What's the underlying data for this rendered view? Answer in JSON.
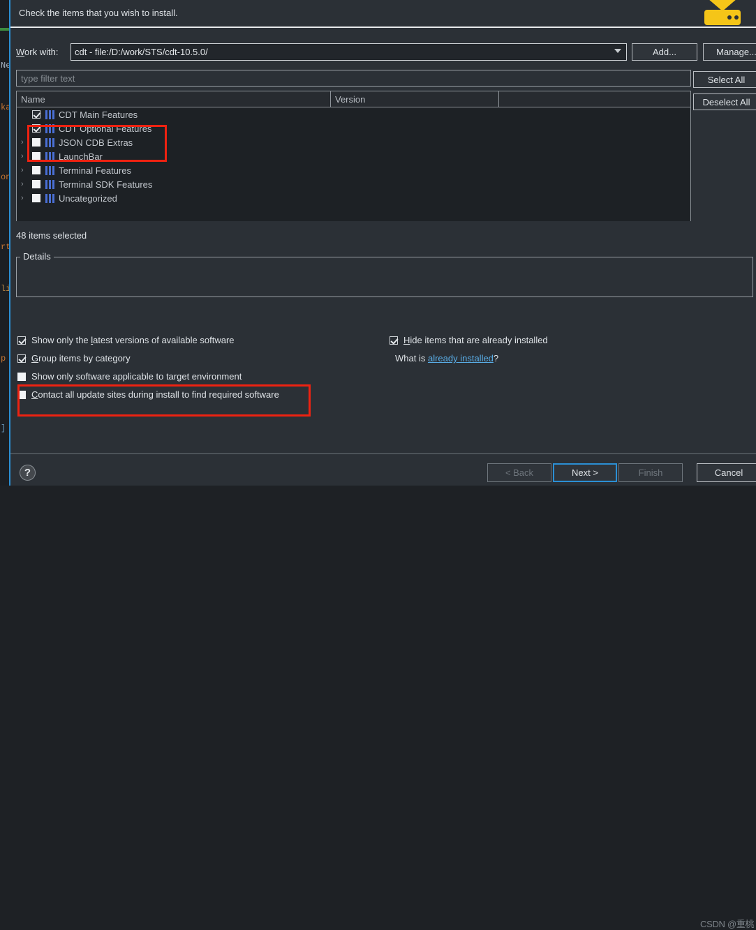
{
  "background_editor": {
    "lines": [
      "",
      "Ne",
      "ka",
      "",
      "on",
      "",
      "rt",
      "li",
      "",
      "p",
      "",
      "]",
      "",
      "",
      ""
    ]
  },
  "header": {
    "title": "Check the items that you wish to install.",
    "icon": "install-wizard-icon",
    "icon_color": "#f5c518"
  },
  "work_with": {
    "label": "Work with:",
    "value": "cdt - file:/D:/work/STS/cdt-10.5.0/",
    "dropdown_icon": "chevron-down-icon",
    "add_label": "Add...",
    "manage_label": "Manage..."
  },
  "filter": {
    "placeholder": "type filter text",
    "value": ""
  },
  "list_buttons": {
    "select_all": "Select All",
    "deselect_all": "Deselect All"
  },
  "tree": {
    "columns": [
      "Name",
      "Version",
      ""
    ],
    "rows": [
      {
        "label": "CDT Main Features",
        "checked": true,
        "expandable": false,
        "icon": "feature-icon"
      },
      {
        "label": "CDT Optional Features",
        "checked": true,
        "expandable": false,
        "icon": "feature-icon"
      },
      {
        "label": "JSON CDB Extras",
        "checked": false,
        "expandable": true,
        "icon": "feature-icon"
      },
      {
        "label": "LaunchBar",
        "checked": false,
        "expandable": true,
        "icon": "feature-icon"
      },
      {
        "label": "Terminal Features",
        "checked": false,
        "expandable": true,
        "icon": "feature-icon"
      },
      {
        "label": "Terminal SDK Features",
        "checked": false,
        "expandable": true,
        "icon": "feature-icon"
      },
      {
        "label": "Uncategorized",
        "checked": false,
        "expandable": true,
        "icon": "feature-icon"
      }
    ],
    "expand_glyph": "›"
  },
  "status": {
    "items_selected": "48 items selected"
  },
  "details": {
    "legend": "Details",
    "content": ""
  },
  "options": {
    "show_latest": {
      "label": "Show only the latest versions of available software",
      "checked": true
    },
    "group_items": {
      "label": "Group items by category",
      "checked": true
    },
    "target_env": {
      "label": "Show only software applicable to target environment",
      "checked": false
    },
    "contact_sites": {
      "label": "Contact all update sites during install to find required software",
      "checked": false
    },
    "hide_installed": {
      "label": "Hide items that are already installed",
      "checked": true
    },
    "whatis_prefix": "What is ",
    "whatis_link": "already installed",
    "whatis_suffix": "?"
  },
  "footer": {
    "help_glyph": "?",
    "back": "< Back",
    "next": "Next >",
    "finish": "Finish",
    "cancel": "Cancel",
    "watermark": "CSDN @重桃"
  },
  "colors": {
    "dialog_bg": "#2b3036",
    "tree_bg": "#1d2125",
    "accent_focus": "#2b8fd4",
    "annotation_red": "#ee2211",
    "link_blue": "#5aaee8",
    "feature_blue": "#4a6fd4"
  }
}
